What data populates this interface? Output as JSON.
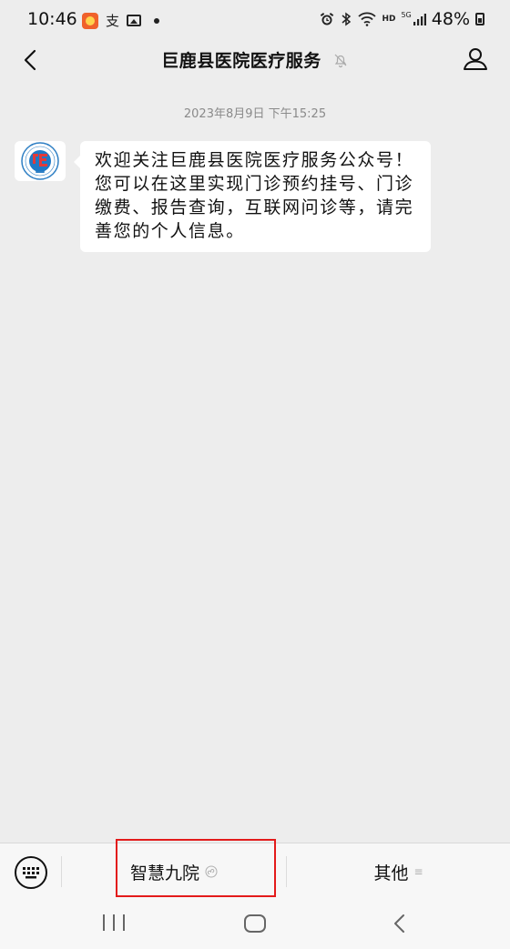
{
  "status_bar": {
    "time": "10:46",
    "battery": "48%",
    "network": "HD",
    "signal_label": "5G",
    "app_glyph": "支"
  },
  "nav": {
    "title": "巨鹿县医院医疗服务"
  },
  "chat": {
    "timestamp": "2023年8月9日 下午15:25",
    "messages": [
      {
        "sender": "hospital",
        "text": "欢迎关注巨鹿县医院医疗服务公众号！您可以在这里实现门诊预约挂号、门诊缴费、报告查询，互联网问诊等，请完善您的个人信息。"
      }
    ]
  },
  "menu": {
    "item1_label": "智慧九院",
    "item2_label": "其他",
    "item2_icon": "≡"
  },
  "colors": {
    "background": "#ededed",
    "bubble": "#ffffff",
    "highlight": "#e31b1b"
  }
}
